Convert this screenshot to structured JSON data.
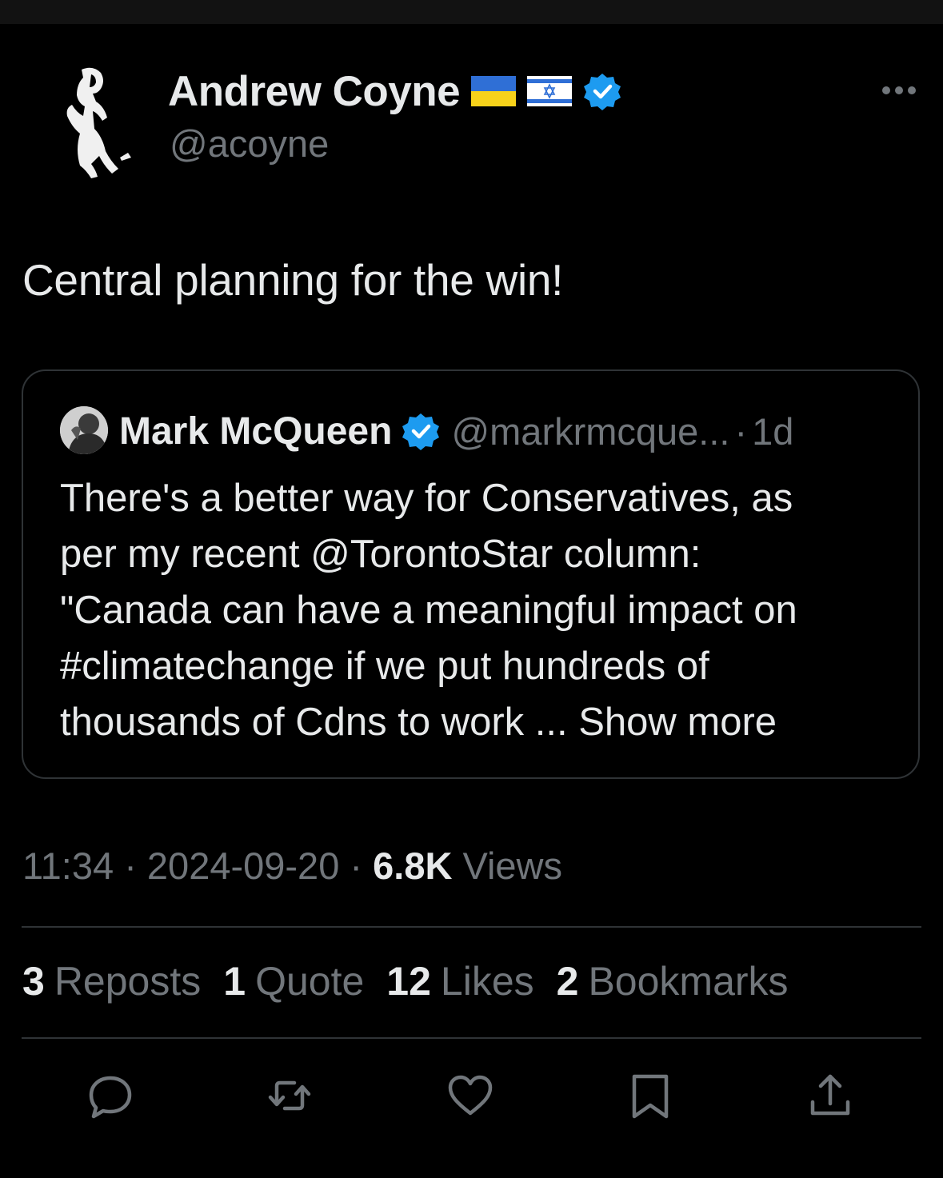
{
  "author": {
    "display_name": "Andrew Coyne",
    "handle": "@acoyne",
    "flags": [
      "ukraine-flag-icon",
      "israel-flag-icon"
    ],
    "verified": true
  },
  "tweet": {
    "text": "Central planning for the win!"
  },
  "quoted_tweet": {
    "display_name": "Mark McQueen",
    "handle": "@markrmcque...",
    "separator": "·",
    "time": "1d",
    "lines": [
      "There's a better way for Conservatives, as",
      "per my recent @TorontoStar column:",
      "\"Canada can have a meaningful impact on",
      "#climatechange if we put hundreds of"
    ],
    "last_line_prefix": "thousands of Cdns to work ... ",
    "show_more": "Show more"
  },
  "meta": {
    "time": "11:34",
    "date": "2024-09-20",
    "separator": "·",
    "views_count": "6.8K",
    "views_label": "Views"
  },
  "stats": {
    "reposts_count": "3",
    "reposts_label": "Reposts",
    "quotes_count": "1",
    "quotes_label": "Quote",
    "likes_count": "12",
    "likes_label": "Likes",
    "bookmarks_count": "2",
    "bookmarks_label": "Bookmarks"
  },
  "actions": [
    "reply-icon",
    "repost-icon",
    "like-icon",
    "bookmark-icon",
    "share-icon"
  ],
  "colors": {
    "background": "#000000",
    "text": "#e7e9ea",
    "muted": "#71767b",
    "border": "#2f3336",
    "verified": "#1d9bf0"
  }
}
